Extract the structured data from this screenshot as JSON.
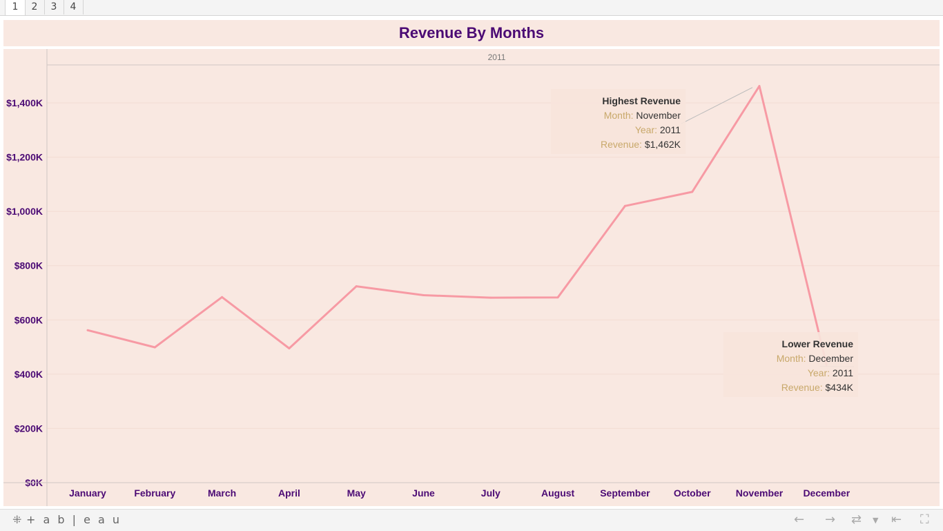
{
  "tabs": [
    "1",
    "2",
    "3",
    "4"
  ],
  "dashboard": {
    "title": "Revenue By Months"
  },
  "chart_data": {
    "type": "line",
    "column_header": "2011",
    "categories": [
      "January",
      "February",
      "March",
      "April",
      "May",
      "June",
      "July",
      "August",
      "September",
      "October",
      "November",
      "December"
    ],
    "series": [
      {
        "values": [
          562,
          499,
          684,
          495,
          724,
          691,
          682,
          683,
          1020,
          1072,
          1462,
          434
        ]
      }
    ],
    "y_ticks": [
      0,
      200,
      400,
      600,
      800,
      1000,
      1200,
      1400
    ],
    "y_tick_labels": [
      "$0K",
      "$200K",
      "$400K",
      "$600K",
      "$800K",
      "$1,000K",
      "$1,200K",
      "$1,400K"
    ],
    "ylim": [
      0,
      1540
    ],
    "grid": true,
    "line_color": "#f79aa4",
    "annotations": [
      {
        "title": "Highest Revenue",
        "month_label": "Month:",
        "month": "November",
        "year_label": "Year:",
        "year": "2011",
        "revenue_label": "Revenue:",
        "revenue": "$1,462K",
        "point_index": 10
      },
      {
        "title": "Lower Revenue",
        "month_label": "Month:",
        "month": "December",
        "year_label": "Year:",
        "year": "2011",
        "revenue_label": "Revenue:",
        "revenue": "$434K",
        "point_index": 11
      }
    ]
  },
  "colors": {
    "background": "#f9e8e1",
    "title": "#4b0a74",
    "axis_labels": "#4b0a74",
    "annotation_label": "#c8a86a",
    "annotation_value": "#333333"
  },
  "footer": {
    "logo_icon": "tableau-logo-icon",
    "logo_text": "+ a b | e a u",
    "buttons": [
      "undo-icon",
      "redo-icon",
      "revert-icon",
      "pause-icon",
      "fullscreen-icon"
    ]
  }
}
